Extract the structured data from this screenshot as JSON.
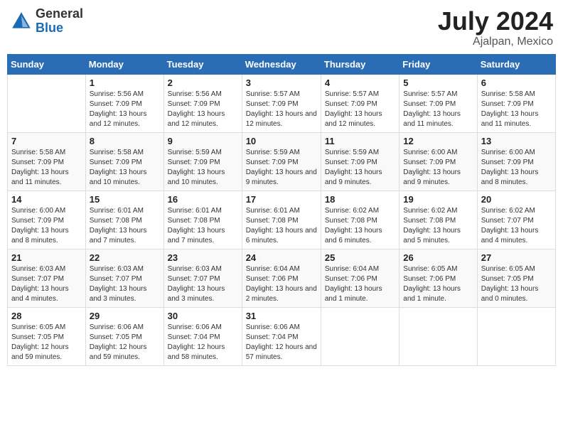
{
  "header": {
    "logo_general": "General",
    "logo_blue": "Blue",
    "month_title": "July 2024",
    "location": "Ajalpan, Mexico"
  },
  "weekdays": [
    "Sunday",
    "Monday",
    "Tuesday",
    "Wednesday",
    "Thursday",
    "Friday",
    "Saturday"
  ],
  "weeks": [
    [
      {
        "day": "",
        "sunrise": "",
        "sunset": "",
        "daylight": ""
      },
      {
        "day": "1",
        "sunrise": "Sunrise: 5:56 AM",
        "sunset": "Sunset: 7:09 PM",
        "daylight": "Daylight: 13 hours and 12 minutes."
      },
      {
        "day": "2",
        "sunrise": "Sunrise: 5:56 AM",
        "sunset": "Sunset: 7:09 PM",
        "daylight": "Daylight: 13 hours and 12 minutes."
      },
      {
        "day": "3",
        "sunrise": "Sunrise: 5:57 AM",
        "sunset": "Sunset: 7:09 PM",
        "daylight": "Daylight: 13 hours and 12 minutes."
      },
      {
        "day": "4",
        "sunrise": "Sunrise: 5:57 AM",
        "sunset": "Sunset: 7:09 PM",
        "daylight": "Daylight: 13 hours and 12 minutes."
      },
      {
        "day": "5",
        "sunrise": "Sunrise: 5:57 AM",
        "sunset": "Sunset: 7:09 PM",
        "daylight": "Daylight: 13 hours and 11 minutes."
      },
      {
        "day": "6",
        "sunrise": "Sunrise: 5:58 AM",
        "sunset": "Sunset: 7:09 PM",
        "daylight": "Daylight: 13 hours and 11 minutes."
      }
    ],
    [
      {
        "day": "7",
        "sunrise": "Sunrise: 5:58 AM",
        "sunset": "Sunset: 7:09 PM",
        "daylight": "Daylight: 13 hours and 11 minutes."
      },
      {
        "day": "8",
        "sunrise": "Sunrise: 5:58 AM",
        "sunset": "Sunset: 7:09 PM",
        "daylight": "Daylight: 13 hours and 10 minutes."
      },
      {
        "day": "9",
        "sunrise": "Sunrise: 5:59 AM",
        "sunset": "Sunset: 7:09 PM",
        "daylight": "Daylight: 13 hours and 10 minutes."
      },
      {
        "day": "10",
        "sunrise": "Sunrise: 5:59 AM",
        "sunset": "Sunset: 7:09 PM",
        "daylight": "Daylight: 13 hours and 9 minutes."
      },
      {
        "day": "11",
        "sunrise": "Sunrise: 5:59 AM",
        "sunset": "Sunset: 7:09 PM",
        "daylight": "Daylight: 13 hours and 9 minutes."
      },
      {
        "day": "12",
        "sunrise": "Sunrise: 6:00 AM",
        "sunset": "Sunset: 7:09 PM",
        "daylight": "Daylight: 13 hours and 9 minutes."
      },
      {
        "day": "13",
        "sunrise": "Sunrise: 6:00 AM",
        "sunset": "Sunset: 7:09 PM",
        "daylight": "Daylight: 13 hours and 8 minutes."
      }
    ],
    [
      {
        "day": "14",
        "sunrise": "Sunrise: 6:00 AM",
        "sunset": "Sunset: 7:09 PM",
        "daylight": "Daylight: 13 hours and 8 minutes."
      },
      {
        "day": "15",
        "sunrise": "Sunrise: 6:01 AM",
        "sunset": "Sunset: 7:08 PM",
        "daylight": "Daylight: 13 hours and 7 minutes."
      },
      {
        "day": "16",
        "sunrise": "Sunrise: 6:01 AM",
        "sunset": "Sunset: 7:08 PM",
        "daylight": "Daylight: 13 hours and 7 minutes."
      },
      {
        "day": "17",
        "sunrise": "Sunrise: 6:01 AM",
        "sunset": "Sunset: 7:08 PM",
        "daylight": "Daylight: 13 hours and 6 minutes."
      },
      {
        "day": "18",
        "sunrise": "Sunrise: 6:02 AM",
        "sunset": "Sunset: 7:08 PM",
        "daylight": "Daylight: 13 hours and 6 minutes."
      },
      {
        "day": "19",
        "sunrise": "Sunrise: 6:02 AM",
        "sunset": "Sunset: 7:08 PM",
        "daylight": "Daylight: 13 hours and 5 minutes."
      },
      {
        "day": "20",
        "sunrise": "Sunrise: 6:02 AM",
        "sunset": "Sunset: 7:07 PM",
        "daylight": "Daylight: 13 hours and 4 minutes."
      }
    ],
    [
      {
        "day": "21",
        "sunrise": "Sunrise: 6:03 AM",
        "sunset": "Sunset: 7:07 PM",
        "daylight": "Daylight: 13 hours and 4 minutes."
      },
      {
        "day": "22",
        "sunrise": "Sunrise: 6:03 AM",
        "sunset": "Sunset: 7:07 PM",
        "daylight": "Daylight: 13 hours and 3 minutes."
      },
      {
        "day": "23",
        "sunrise": "Sunrise: 6:03 AM",
        "sunset": "Sunset: 7:07 PM",
        "daylight": "Daylight: 13 hours and 3 minutes."
      },
      {
        "day": "24",
        "sunrise": "Sunrise: 6:04 AM",
        "sunset": "Sunset: 7:06 PM",
        "daylight": "Daylight: 13 hours and 2 minutes."
      },
      {
        "day": "25",
        "sunrise": "Sunrise: 6:04 AM",
        "sunset": "Sunset: 7:06 PM",
        "daylight": "Daylight: 13 hours and 1 minute."
      },
      {
        "day": "26",
        "sunrise": "Sunrise: 6:05 AM",
        "sunset": "Sunset: 7:06 PM",
        "daylight": "Daylight: 13 hours and 1 minute."
      },
      {
        "day": "27",
        "sunrise": "Sunrise: 6:05 AM",
        "sunset": "Sunset: 7:05 PM",
        "daylight": "Daylight: 13 hours and 0 minutes."
      }
    ],
    [
      {
        "day": "28",
        "sunrise": "Sunrise: 6:05 AM",
        "sunset": "Sunset: 7:05 PM",
        "daylight": "Daylight: 12 hours and 59 minutes."
      },
      {
        "day": "29",
        "sunrise": "Sunrise: 6:06 AM",
        "sunset": "Sunset: 7:05 PM",
        "daylight": "Daylight: 12 hours and 59 minutes."
      },
      {
        "day": "30",
        "sunrise": "Sunrise: 6:06 AM",
        "sunset": "Sunset: 7:04 PM",
        "daylight": "Daylight: 12 hours and 58 minutes."
      },
      {
        "day": "31",
        "sunrise": "Sunrise: 6:06 AM",
        "sunset": "Sunset: 7:04 PM",
        "daylight": "Daylight: 12 hours and 57 minutes."
      },
      {
        "day": "",
        "sunrise": "",
        "sunset": "",
        "daylight": ""
      },
      {
        "day": "",
        "sunrise": "",
        "sunset": "",
        "daylight": ""
      },
      {
        "day": "",
        "sunrise": "",
        "sunset": "",
        "daylight": ""
      }
    ]
  ]
}
